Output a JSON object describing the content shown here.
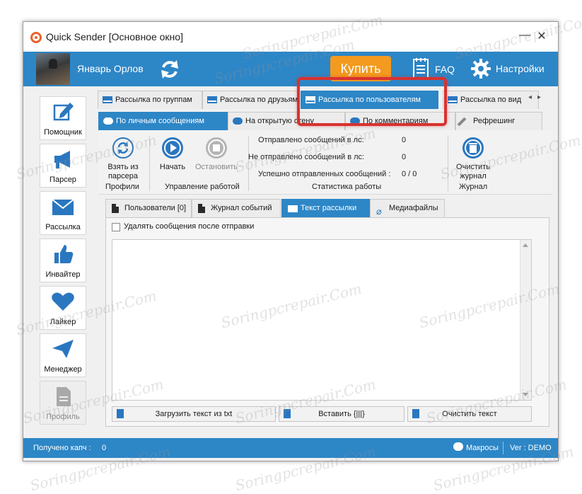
{
  "window": {
    "title": "Quick Sender [Основное окно]",
    "minimize": "—",
    "close": "✕"
  },
  "header": {
    "username": "Январь Орлов",
    "buy_label": "Купить",
    "faq_label": "FAQ",
    "settings_label": "Настройки"
  },
  "sidebar": {
    "items": [
      {
        "label": "Помощник",
        "icon": "pencil-square-icon"
      },
      {
        "label": "Парсер",
        "icon": "megaphone-icon"
      },
      {
        "label": "Рассылка",
        "icon": "envelope-icon"
      },
      {
        "label": "Инвайтер",
        "icon": "thumbs-up-icon"
      },
      {
        "label": "Лайкер",
        "icon": "heart-icon"
      },
      {
        "label": "Менеджер",
        "icon": "paper-plane-icon"
      },
      {
        "label": "Профиль",
        "icon": "document-icon"
      }
    ]
  },
  "tabs_main": [
    {
      "label": "Рассылка по группам"
    },
    {
      "label": "Рассылка по друзьям"
    },
    {
      "label": "Рассылка по пользователям"
    },
    {
      "label": "Рассылка по вид"
    }
  ],
  "tabs_sub": [
    {
      "label": "По личным сообщениям"
    },
    {
      "label": "На открытую стену"
    },
    {
      "label": "По комментариям"
    },
    {
      "label": "Рефрешинг"
    }
  ],
  "toolbar": {
    "take_from_parser": "Взять из парсера",
    "profiles_group": "Профили",
    "start": "Начать",
    "stop": "Остановить",
    "control_group": "Управление работой",
    "stats": [
      {
        "label": "Отправлено сообщений в лс:",
        "value": "0"
      },
      {
        "label": "Не отправлено сообщений в лс:",
        "value": "0"
      },
      {
        "label": "Успешно отправленных сообщений :",
        "value": "0 / 0"
      }
    ],
    "stats_group": "Статистика работы",
    "clear_log": "Очистить журнал",
    "log_group": "Журнал"
  },
  "tabs_content": [
    {
      "label": "Пользователи [0]"
    },
    {
      "label": "Журнал событий"
    },
    {
      "label": "Текст рассылки"
    },
    {
      "label": "Медиафайлы"
    }
  ],
  "message_panel": {
    "delete_after_send": "Удалять сообщения после отправки",
    "load_txt": "Загрузить текст из txt",
    "insert": "Вставить {|||}",
    "clear_text": "Очистить текст"
  },
  "status": {
    "captcha_label": "Получено капч :",
    "captcha_value": "0",
    "macros": "Макросы",
    "version": "Ver : DEMO"
  },
  "colors": {
    "accent": "#2d86c6",
    "buy": "#f39a1f",
    "highlight": "#d8322f"
  },
  "watermark": "Soringpcrepair.Com"
}
